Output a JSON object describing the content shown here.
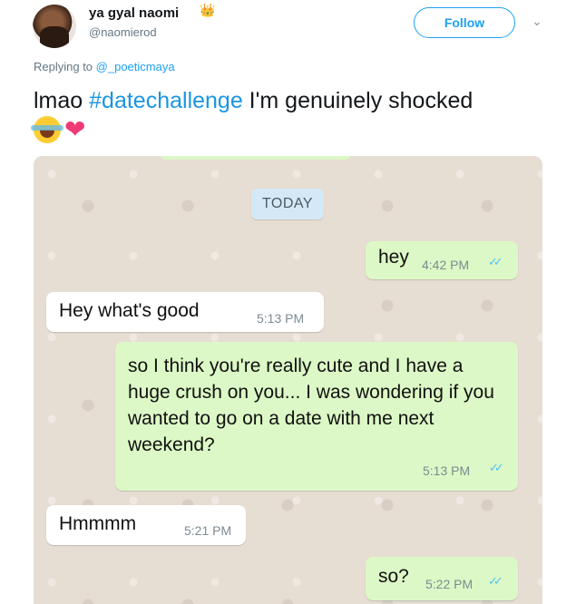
{
  "tweet": {
    "display_name": "ya gyal naomi",
    "name_emoji": "👑",
    "handle": "@naomierod",
    "follow_label": "Follow",
    "reply_prefix": "Replying to",
    "reply_to": "@_poeticmaya",
    "text_before": "lmao ",
    "hashtag": "#datechallenge",
    "text_after": " I'm genuinely shocked",
    "emojis": [
      "face-with-tears-of-joy",
      "sparkling-heart"
    ]
  },
  "chat": {
    "date_label": "TODAY",
    "messages": [
      {
        "dir": "out",
        "text": "hey",
        "time": "4:42 PM",
        "ticks": "✓✓"
      },
      {
        "dir": "in",
        "text": "Hey what's good",
        "time": "5:13 PM"
      },
      {
        "dir": "out",
        "text": "so I think you're really cute and I have a huge crush on you... I was wondering if you wanted to go on a date with me next weekend?",
        "time": "5:13 PM",
        "ticks": "✓✓"
      },
      {
        "dir": "in",
        "text": "Hmmmm",
        "time": "5:21 PM"
      },
      {
        "dir": "out",
        "text": "so?",
        "time": "5:22 PM",
        "ticks": "✓✓"
      }
    ]
  },
  "colors": {
    "link_blue": "#1da1f2",
    "out_bubble": "#dcf8c6",
    "in_bubble": "#ffffff",
    "chat_bg": "#e6ddd3",
    "read_ticks": "#4fc3f7"
  }
}
